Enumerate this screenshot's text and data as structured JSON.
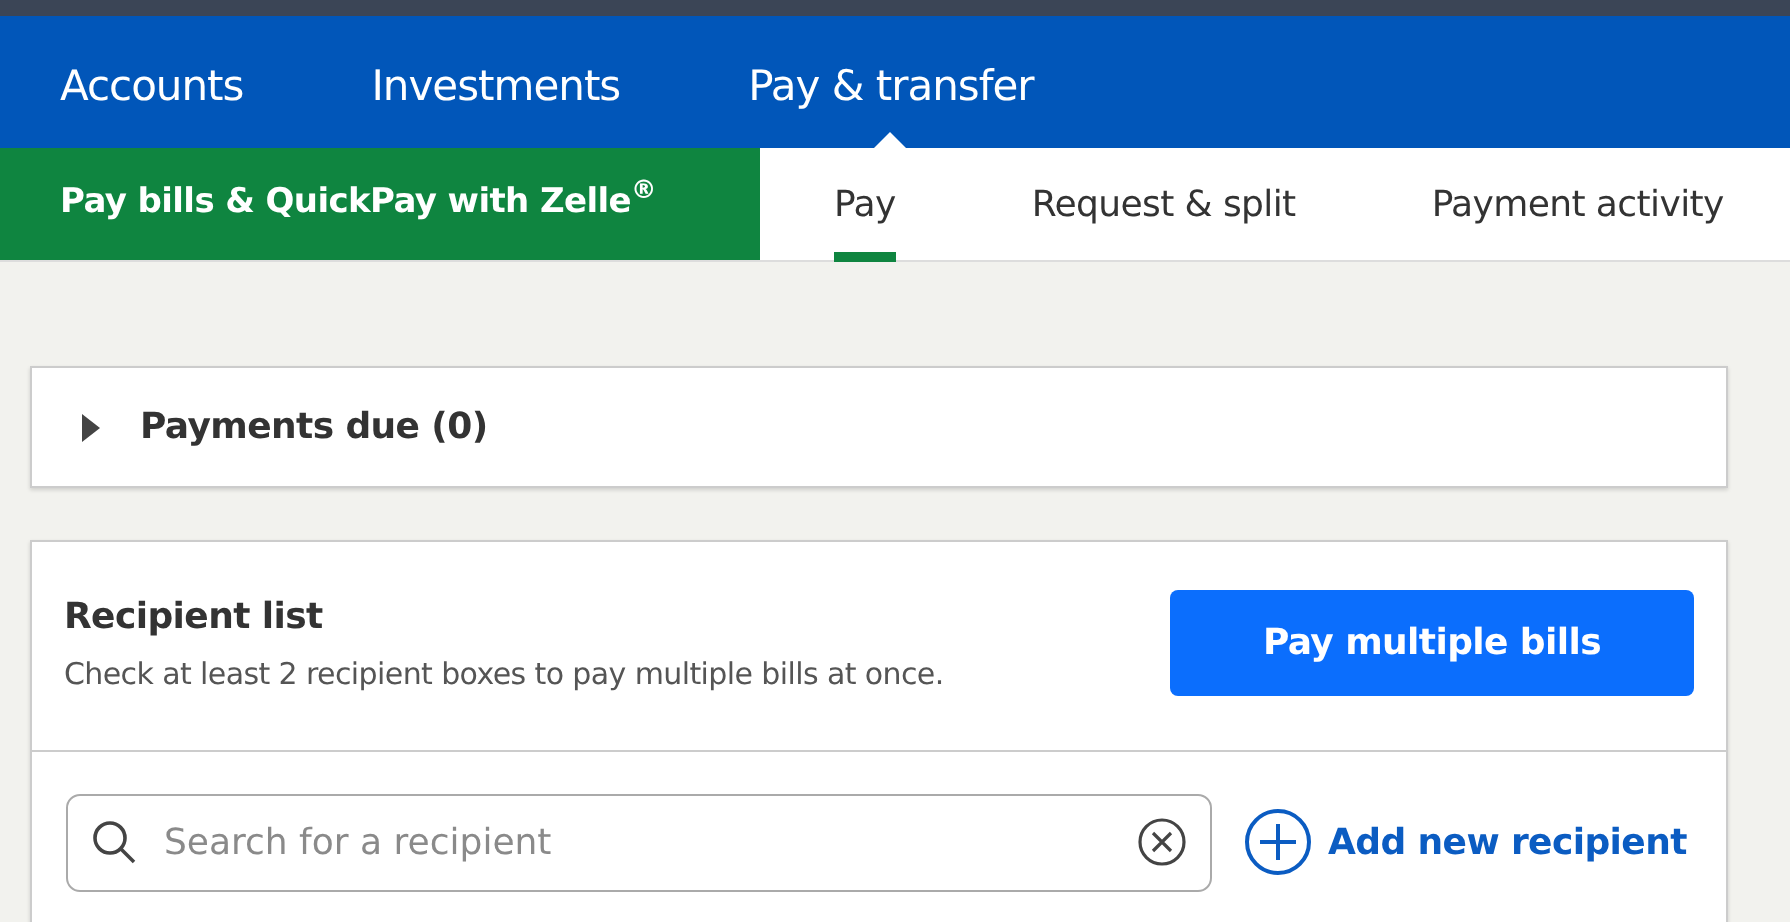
{
  "top_nav": [
    {
      "label": "Accounts",
      "selected": false
    },
    {
      "label": "Investments",
      "selected": false
    },
    {
      "label": "Pay & transfer",
      "selected": true
    }
  ],
  "sub_nav": {
    "title": "Pay bills & QuickPay with Zelle$^{®}$",
    "tabs": [
      {
        "label": "Pay",
        "selected": true
      },
      {
        "label": "Request & split",
        "selected": false
      },
      {
        "label": "Payment activity",
        "selected": false
      }
    ]
  },
  "payments_due": {
    "label": "Payments due (0)",
    "expanded": false
  },
  "recipient_list": {
    "title": "Recipient list",
    "description": "Check at least 2 recipient boxes to pay multiple bills at once.",
    "button": "Pay multiple bills",
    "search": {
      "placeholder": "Search for a recipient"
    },
    "add_link": "Add new recipient"
  }
}
